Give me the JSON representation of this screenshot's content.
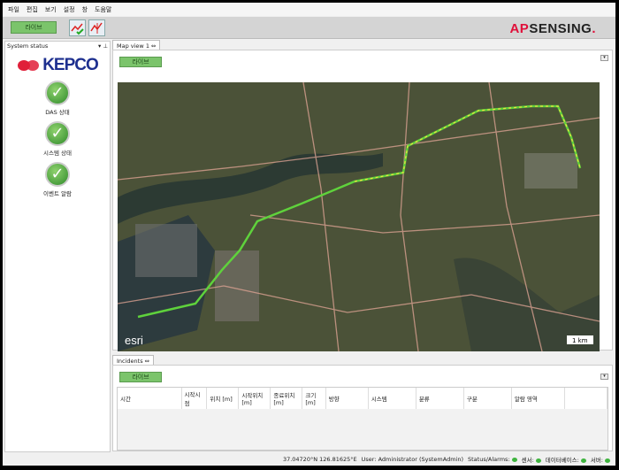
{
  "menu": [
    "파일",
    "편집",
    "보기",
    "설정",
    "창",
    "도움말"
  ],
  "toolbar": {
    "live_label": "라이브",
    "icons": [
      "trend-check-icon",
      "trend-chart-icon"
    ]
  },
  "brand": {
    "logo_prefix": "AP",
    "logo_main": "SENSING",
    "logo_dot": ".",
    "accent": "#e0103a"
  },
  "system_status": {
    "title": "System status",
    "logo": "KEPCO",
    "items": [
      {
        "label": "DAS 상태",
        "state": "ok"
      },
      {
        "label": "시스템 상태",
        "state": "ok"
      },
      {
        "label": "이벤트 알람",
        "state": "ok"
      }
    ]
  },
  "map_view": {
    "tab": "Map view 1",
    "live_label": "라이브",
    "attribution": "esri",
    "scale": "1 km",
    "route_color": "#5fd23c",
    "route_highlight": "#f0e040"
  },
  "incidents": {
    "tab": "Incidents",
    "live_label": "라이브",
    "columns": [
      "시간",
      "시작시점",
      "위치 [m]",
      "시작위치 [m]",
      "종료위치 [m]",
      "크기 [m]",
      "방향",
      "시스템",
      "분류",
      "구분",
      "알람 영역",
      ""
    ],
    "rows": []
  },
  "statusbar": {
    "coords": "37.04720°N  126.81625°E",
    "user": "User: Administrator (SystemAdmin)",
    "status_alarms": "Status/Alarms:",
    "sensor": "센서:",
    "database": "데이터베이스:",
    "server": "서버:"
  }
}
